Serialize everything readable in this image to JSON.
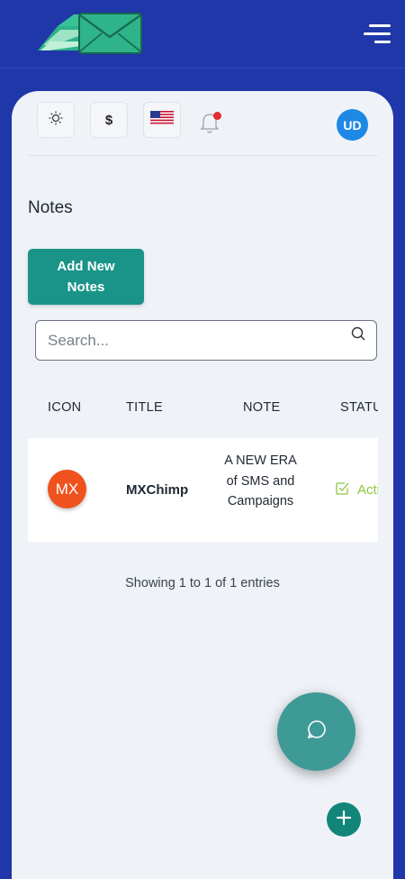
{
  "header": {
    "logo_icon": "envelope-logo-icon",
    "menu_icon": "hamburger-menu-icon"
  },
  "toolbar": {
    "theme_icon": "sun-icon",
    "currency_label": "$",
    "language_icon": "us-flag-icon",
    "notification_icon": "bell-icon",
    "user_initials": "UD"
  },
  "page": {
    "title": "Notes",
    "add_button_label": "Add New Notes"
  },
  "search": {
    "placeholder": "Search...",
    "value": "",
    "icon": "search-icon"
  },
  "table": {
    "columns": [
      "ICON",
      "TITLE",
      "NOTE",
      "STATUS"
    ],
    "rows": [
      {
        "icon_initials": "MX",
        "title": "MXChimp",
        "note": "A NEW ERA of SMS and Campaigns",
        "status": "Active"
      }
    ],
    "footer": "Showing 1 to 1 of 1 entries"
  },
  "fabs": {
    "chat_icon": "chat-bubble-icon",
    "add_icon": "plus-icon"
  },
  "colors": {
    "background": "#1f37a8",
    "card": "#eff3f8",
    "accent_teal": "#1a9488",
    "avatar_user": "#1e88e5",
    "avatar_row": "#f0521e",
    "status_active": "#8dc63f"
  }
}
